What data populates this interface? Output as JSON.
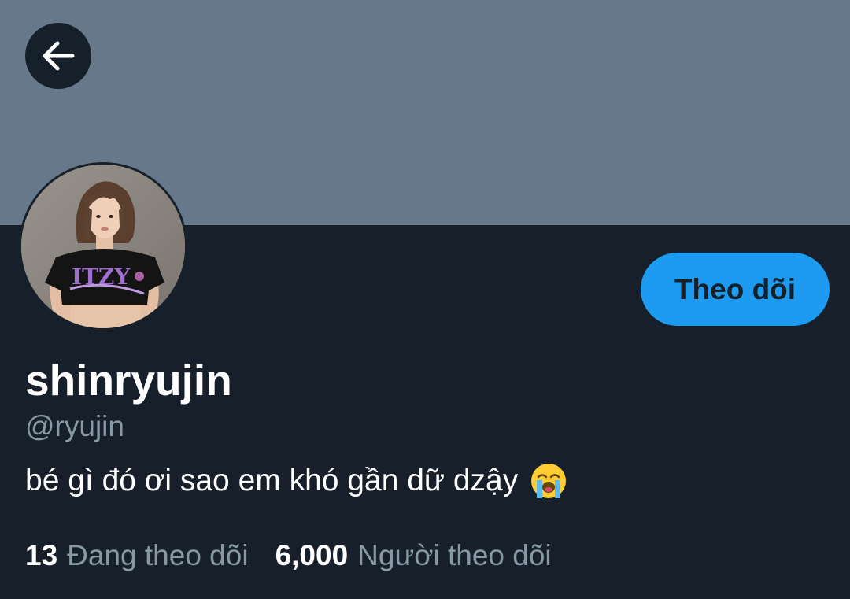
{
  "header": {
    "back_icon": "arrow-left-icon",
    "banner_color": "#66788a"
  },
  "profile": {
    "avatar_description": "profile-photo",
    "follow_button_label": "Theo dõi",
    "display_name": "shinryujin",
    "handle": "@ryujin",
    "bio_text": "bé gì đó ơi sao em khó gần dữ dzậy",
    "bio_emoji_icon": "loudly-crying-face-emoji"
  },
  "stats": {
    "following_count": "13",
    "following_label": "Đang theo dõi",
    "followers_count": "6,000",
    "followers_label": "Người theo dõi"
  },
  "colors": {
    "background": "#17202a",
    "accent": "#1d9bf0",
    "secondary_text": "#8899a6",
    "primary_text": "#ffffff"
  }
}
